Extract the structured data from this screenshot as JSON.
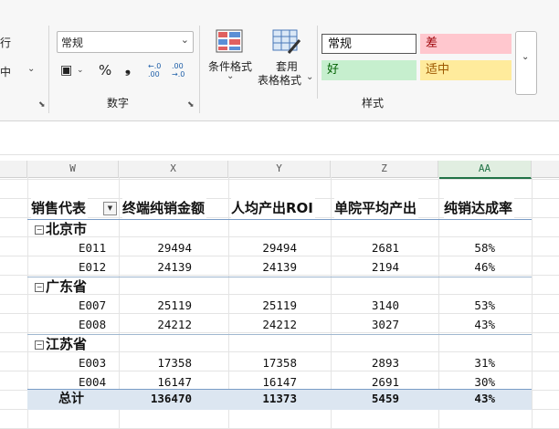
{
  "ribbon": {
    "align_partial": "行",
    "merge_partial": "中",
    "number_format_value": "常规",
    "number_group_label": "数字",
    "conditional_format_label": "条件格式",
    "table_format_label_1": "套用",
    "table_format_label_2": "表格格式",
    "styles_group_label": "样式",
    "style_normal": "常规",
    "style_bad": "差",
    "style_good": "好",
    "style_neutral": "适中",
    "percent_symbol": "%",
    "comma_symbol": "❟",
    "inc_decimal": "←.0 .00",
    "dec_decimal": ".00 →.0"
  },
  "colors": {
    "bad_bg": "#ffc7ce",
    "bad_fg": "#9c0006",
    "good_bg": "#c6efce",
    "good_fg": "#006100",
    "neutral_bg": "#ffeb9c",
    "neutral_fg": "#9c5700",
    "selected_col": "#217346",
    "total_row_bg": "#dce6f1"
  },
  "columns": [
    "W",
    "X",
    "Y",
    "Z",
    "AA"
  ],
  "pivot": {
    "headers": [
      "销售代表",
      "终端纯销金额",
      "人均产出ROI",
      "单院平均产出",
      "纯销达成率"
    ],
    "groups": [
      {
        "name": "北京市",
        "rows": [
          {
            "rep": "E011",
            "sales": "29494",
            "roi": "29494",
            "avg": "2681",
            "rate": "58%"
          },
          {
            "rep": "E012",
            "sales": "24139",
            "roi": "24139",
            "avg": "2194",
            "rate": "46%"
          }
        ]
      },
      {
        "name": "广东省",
        "rows": [
          {
            "rep": "E007",
            "sales": "25119",
            "roi": "25119",
            "avg": "3140",
            "rate": "53%"
          },
          {
            "rep": "E008",
            "sales": "24212",
            "roi": "24212",
            "avg": "3027",
            "rate": "43%"
          }
        ]
      },
      {
        "name": "江苏省",
        "rows": [
          {
            "rep": "E003",
            "sales": "17358",
            "roi": "17358",
            "avg": "2893",
            "rate": "31%"
          },
          {
            "rep": "E004",
            "sales": "16147",
            "roi": "16147",
            "avg": "2691",
            "rate": "30%"
          }
        ]
      }
    ],
    "total": {
      "label": "总计",
      "sales": "136470",
      "roi": "11373",
      "avg": "5459",
      "rate": "43%"
    }
  }
}
